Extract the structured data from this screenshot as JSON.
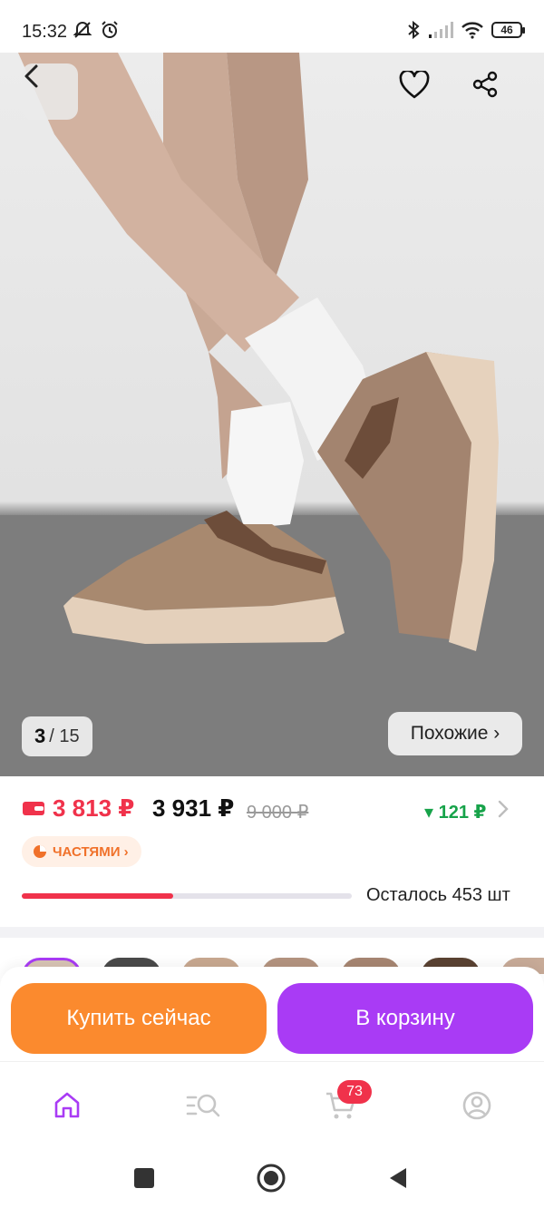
{
  "status_bar": {
    "time": "15:32",
    "battery": "46"
  },
  "gallery": {
    "current": "3",
    "total": "/ 15",
    "similar_label": "Похожие ›"
  },
  "price": {
    "card_price": "3 813 ₽",
    "regular_price": "3 931 ₽",
    "old_price": "9 000 ₽",
    "price_drop": "▾ 121 ₽",
    "installments_label": "ЧАСТЯМИ ›",
    "stock_text": "Осталось 453 шт",
    "stock_progress_percent": 46
  },
  "actions": {
    "buy_now": "Купить сейчас",
    "add_to_cart": "В корзину"
  },
  "bottom_nav": {
    "items": [
      "home-icon",
      "catalog-search-icon",
      "cart-icon",
      "profile-icon"
    ],
    "cart_badge": "73"
  },
  "colors": {
    "accent_purple": "#a93bf5",
    "buy_orange": "#fb8a2e",
    "price_red": "#f0324b",
    "drop_green": "#17a34a"
  }
}
